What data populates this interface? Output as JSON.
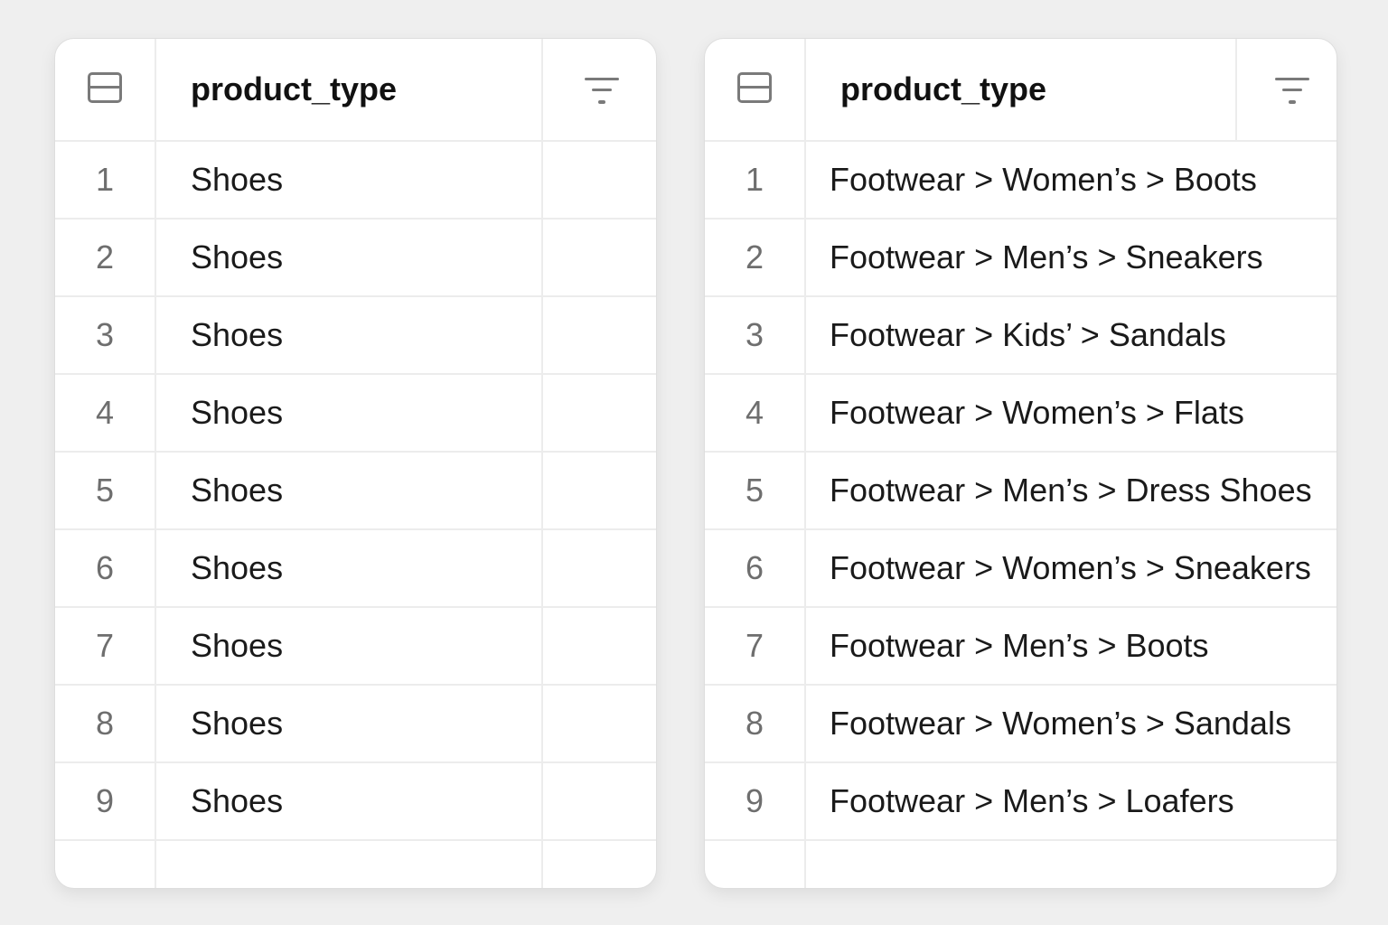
{
  "left_table": {
    "column_header": "product_type",
    "header_icon": "row-layout-icon",
    "filter_icon": "filter-icon",
    "rows": [
      {
        "num": "1",
        "value": "Shoes"
      },
      {
        "num": "2",
        "value": "Shoes"
      },
      {
        "num": "3",
        "value": "Shoes"
      },
      {
        "num": "4",
        "value": "Shoes"
      },
      {
        "num": "5",
        "value": "Shoes"
      },
      {
        "num": "6",
        "value": "Shoes"
      },
      {
        "num": "7",
        "value": "Shoes"
      },
      {
        "num": "8",
        "value": "Shoes"
      },
      {
        "num": "9",
        "value": "Shoes"
      }
    ]
  },
  "right_table": {
    "column_header": "product_type",
    "header_icon": "row-layout-icon",
    "filter_icon": "filter-icon",
    "rows": [
      {
        "num": "1",
        "value": "Footwear > Women’s > Boots"
      },
      {
        "num": "2",
        "value": "Footwear > Men’s > Sneakers"
      },
      {
        "num": "3",
        "value": "Footwear > Kids’ > Sandals"
      },
      {
        "num": "4",
        "value": "Footwear > Women’s > Flats"
      },
      {
        "num": "5",
        "value": "Footwear > Men’s > Dress Shoes"
      },
      {
        "num": "6",
        "value": "Footwear > Women’s > Sneakers"
      },
      {
        "num": "7",
        "value": "Footwear > Men’s > Boots"
      },
      {
        "num": "8",
        "value": "Footwear > Women’s > Sandals"
      },
      {
        "num": "9",
        "value": "Footwear > Men’s > Loafers"
      }
    ]
  },
  "colors": {
    "page_background": "#efefef",
    "panel_background": "#ffffff",
    "grid_line": "#ececec",
    "icon": "#7a7a7a",
    "header_text": "#111111",
    "cell_text": "#1a1a1a",
    "row_number_text": "#6e6e6e"
  }
}
